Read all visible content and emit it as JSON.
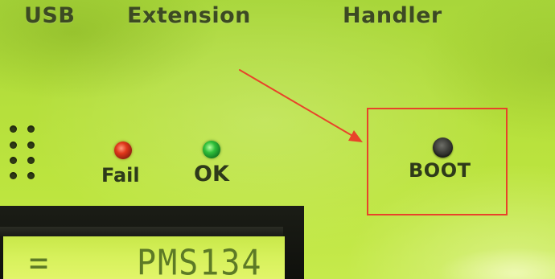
{
  "top_labels": {
    "usb": "USB",
    "extension": "Extension",
    "handler": "Handler"
  },
  "indicators": {
    "fail_label": "Fail",
    "ok_label": "OK",
    "fail_color": "#e0371a",
    "ok_color": "#2fbf3a"
  },
  "boot": {
    "label": "BOOT"
  },
  "annotation": {
    "highlight_color": "#e8432a",
    "arrow_target": "boot-button"
  },
  "lcd": {
    "left_text": "=",
    "model_text": "PMS134"
  }
}
